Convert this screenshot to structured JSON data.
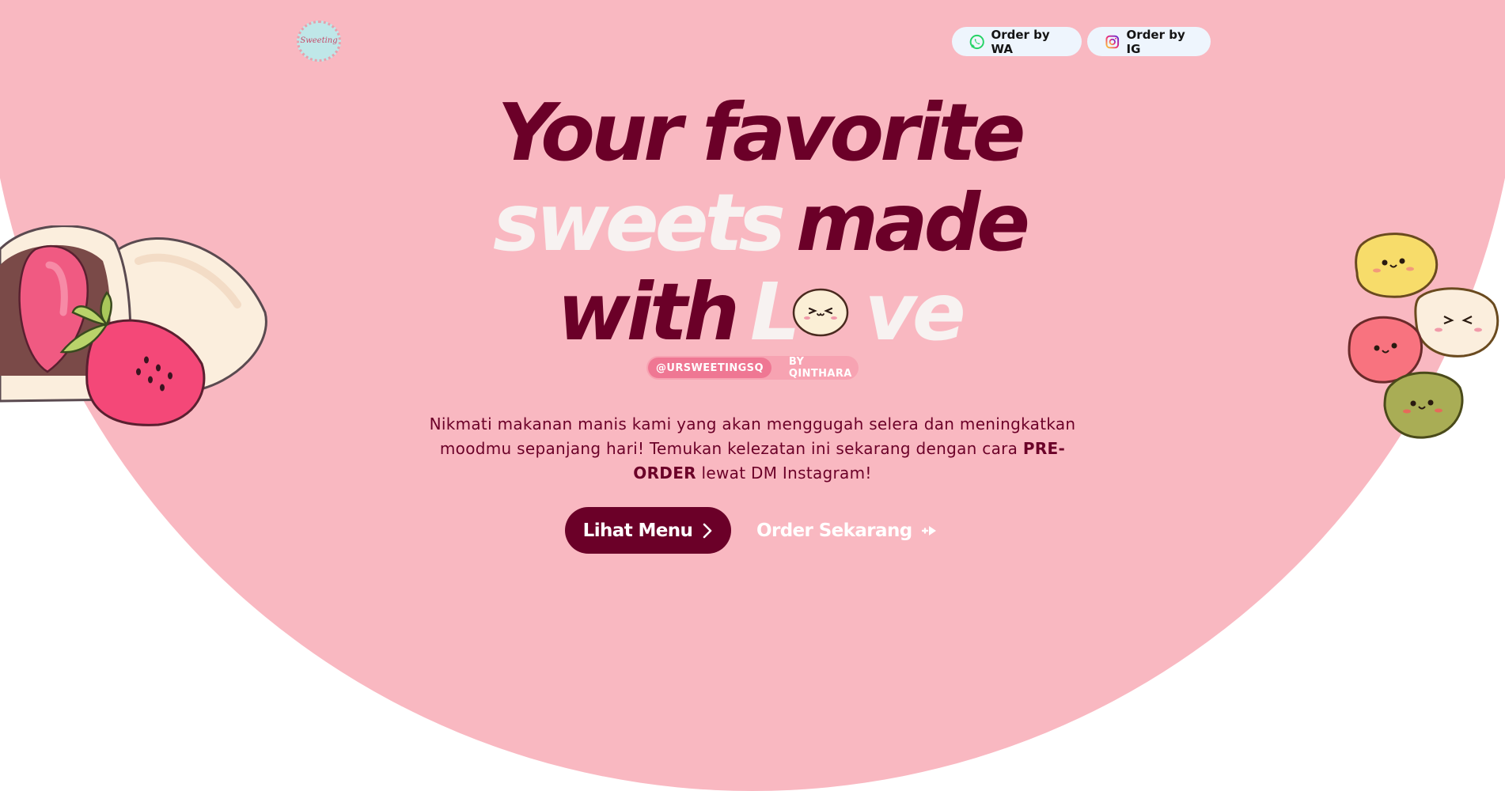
{
  "brand": {
    "logo_text": "Sweeting"
  },
  "nav": {
    "order_wa": {
      "label": "Order by WA",
      "icon": "whatsapp-icon"
    },
    "order_ig": {
      "label": "Order by IG",
      "icon": "instagram-icon"
    }
  },
  "hero": {
    "line1": "Your favorite",
    "line2_light": "sweets",
    "line2_dark": "made",
    "line3_dark": "with",
    "line3_light_l": "L",
    "line3_light_rest": "ve",
    "handle": "@URSWEETINGSQ",
    "byline": "BY QINTHARA",
    "description_1": "Nikmati makanan manis kami yang akan menggugah selera dan meningkatkan moodmu sepanjang hari! Temukan kelezatan ini sekarang dengan cara ",
    "description_bold": "PRE-ORDER",
    "description_2": " lewat DM Instagram!",
    "cta_primary": "Lihat Menu",
    "cta_secondary": "Order Sekarang"
  },
  "colors": {
    "background_pink": "#f9b8c1",
    "accent_maroon": "#6b0028",
    "light_text": "#f7f2f1",
    "pill": "#f7a3b2",
    "pill_handle": "#ef7793",
    "button_light": "#eef5fd"
  }
}
